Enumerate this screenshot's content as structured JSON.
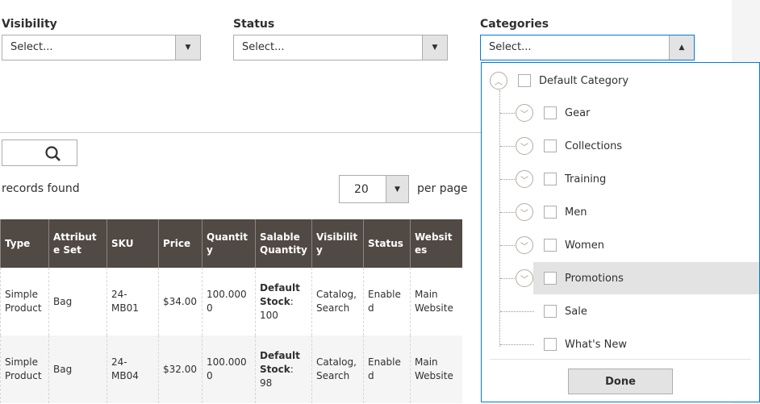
{
  "filters": {
    "visibility": {
      "label": "Visibility",
      "value": "Select..."
    },
    "status": {
      "label": "Status",
      "value": "Select..."
    },
    "categories": {
      "label": "Categories",
      "value": "Select..."
    }
  },
  "records_found_text": "records found",
  "per_page": {
    "value": "20",
    "label": "per page"
  },
  "table": {
    "headers": [
      "Type",
      "Attribute Set",
      "SKU",
      "Price",
      "Quantity",
      "Salable Quantity",
      "Visibility",
      "Status",
      "Websites"
    ],
    "rows": [
      {
        "type": "Simple Product",
        "attribute_set": "Bag",
        "sku": "24-MB01",
        "price": "$34.00",
        "quantity": "100.0000",
        "salable_label": "Default Stock",
        "salable_value": "100",
        "visibility": "Catalog, Search",
        "status": "Enabled",
        "websites": "Main Website"
      },
      {
        "type": "Simple Product",
        "attribute_set": "Bag",
        "sku": "24-MB04",
        "price": "$32.00",
        "quantity": "100.0000",
        "salable_label": "Default Stock",
        "salable_value": "98",
        "visibility": "Catalog, Search",
        "status": "Enabled",
        "websites": "Main Website"
      }
    ]
  },
  "category_tree": {
    "root": "Default Category",
    "children": [
      "Gear",
      "Collections",
      "Training",
      "Men",
      "Women",
      "Promotions",
      "Sale",
      "What's New"
    ],
    "done_label": "Done"
  }
}
